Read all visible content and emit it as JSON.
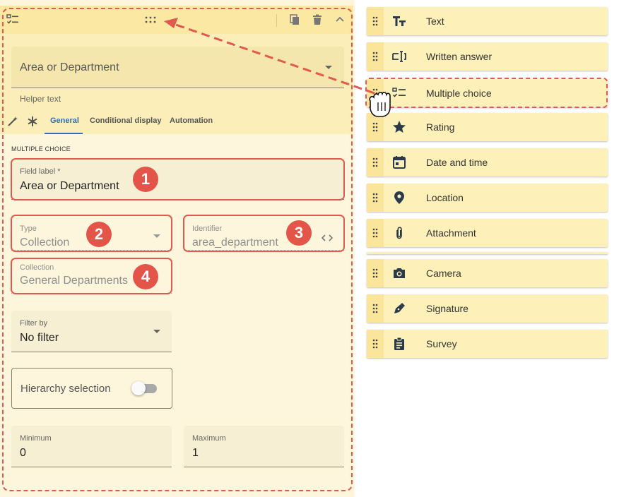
{
  "editor": {
    "select_value": "Area or Department",
    "helper_text": "Helper text",
    "tabs": [
      "General",
      "Conditional display",
      "Automation"
    ],
    "section_title": "MULTIPLE CHOICE",
    "field_label": {
      "label": "Field label *",
      "value": "Area or Department"
    },
    "type": {
      "label": "Type",
      "value": "Collection"
    },
    "identifier": {
      "label": "Identifier",
      "value": "area_department"
    },
    "collection": {
      "label": "Collection",
      "value": "General Departments"
    },
    "filter_by": {
      "label": "Filter by",
      "value": "No filter"
    },
    "hierarchy_selection": {
      "label": "Hierarchy selection",
      "enabled": false
    },
    "minimum": {
      "label": "Minimum",
      "value": "0"
    },
    "maximum": {
      "label": "Maximum",
      "value": "1"
    }
  },
  "badges": [
    "1",
    "2",
    "3",
    "4"
  ],
  "palette": [
    {
      "label": "Text",
      "icon": "text-format-icon"
    },
    {
      "label": "Written answer",
      "icon": "text-cursor-field-icon"
    },
    {
      "label": "Multiple choice",
      "icon": "checklist-icon"
    },
    {
      "label": "Rating",
      "icon": "star-icon"
    },
    {
      "label": "Date and time",
      "icon": "calendar-icon"
    },
    {
      "label": "Location",
      "icon": "location-pin-icon"
    },
    {
      "label": "Attachment",
      "icon": "paperclip-icon"
    },
    {
      "label": "Camera",
      "icon": "camera-icon"
    },
    {
      "label": "Signature",
      "icon": "pen-nib-icon"
    },
    {
      "label": "Survey",
      "icon": "clipboard-icon"
    }
  ],
  "colors": {
    "accent_red": "#e05a50",
    "active_tab": "#2f6db4",
    "icon_dark": "#2b3a4a"
  }
}
